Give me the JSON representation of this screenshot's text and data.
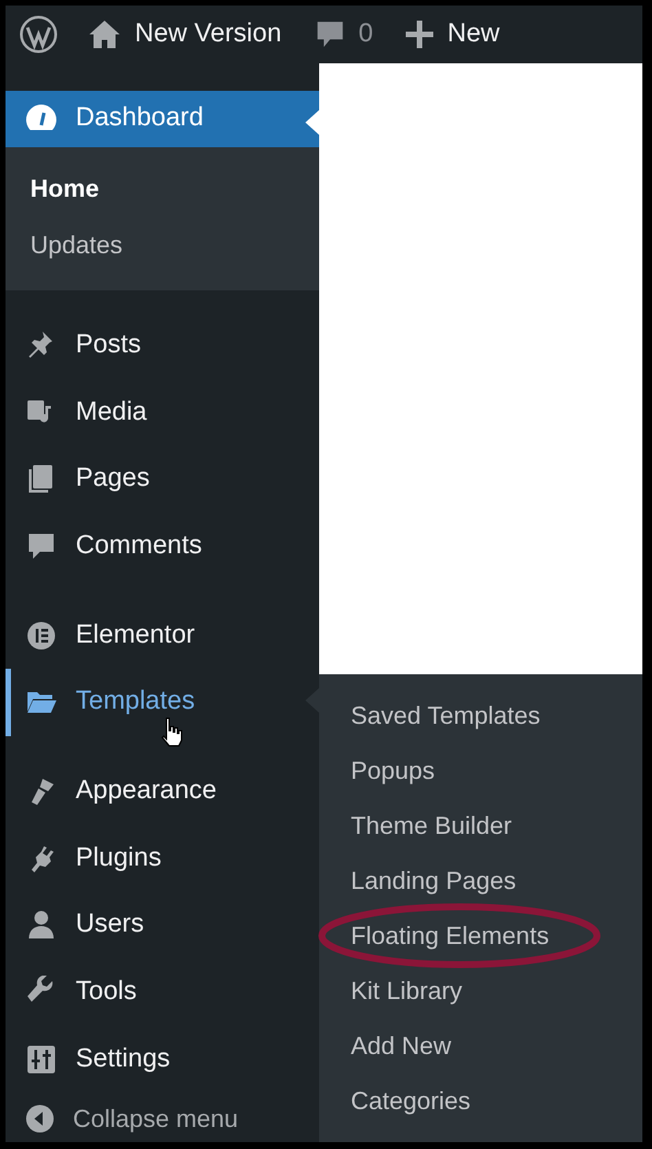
{
  "admin_bar": {
    "site_name": "New Version",
    "comments_count": "0",
    "new_label": "New"
  },
  "sidebar": {
    "current": {
      "label": "Dashboard",
      "selected": true,
      "submenu": [
        {
          "label": "Home",
          "selected": true
        },
        {
          "label": "Updates",
          "selected": false
        }
      ]
    },
    "groups": [
      [
        {
          "label": "Posts",
          "hovered": false
        },
        {
          "label": "Media",
          "hovered": false
        },
        {
          "label": "Pages",
          "hovered": false
        },
        {
          "label": "Comments",
          "hovered": false
        }
      ],
      [
        {
          "label": "Elementor",
          "hovered": false
        },
        {
          "label": "Templates",
          "hovered": true
        }
      ],
      [
        {
          "label": "Appearance",
          "hovered": false
        },
        {
          "label": "Plugins",
          "hovered": false
        },
        {
          "label": "Users",
          "hovered": false
        },
        {
          "label": "Tools",
          "hovered": false
        },
        {
          "label": "Settings",
          "hovered": false
        }
      ]
    ],
    "collapse_label": "Collapse menu"
  },
  "flyout": [
    {
      "label": "Saved Templates",
      "circled": false
    },
    {
      "label": "Popups",
      "circled": false
    },
    {
      "label": "Theme Builder",
      "circled": false
    },
    {
      "label": "Landing Pages",
      "circled": false
    },
    {
      "label": "Floating Elements",
      "circled": true
    },
    {
      "label": "Kit Library",
      "circled": false
    },
    {
      "label": "Add New",
      "circled": false
    },
    {
      "label": "Categories",
      "circled": false
    }
  ]
}
